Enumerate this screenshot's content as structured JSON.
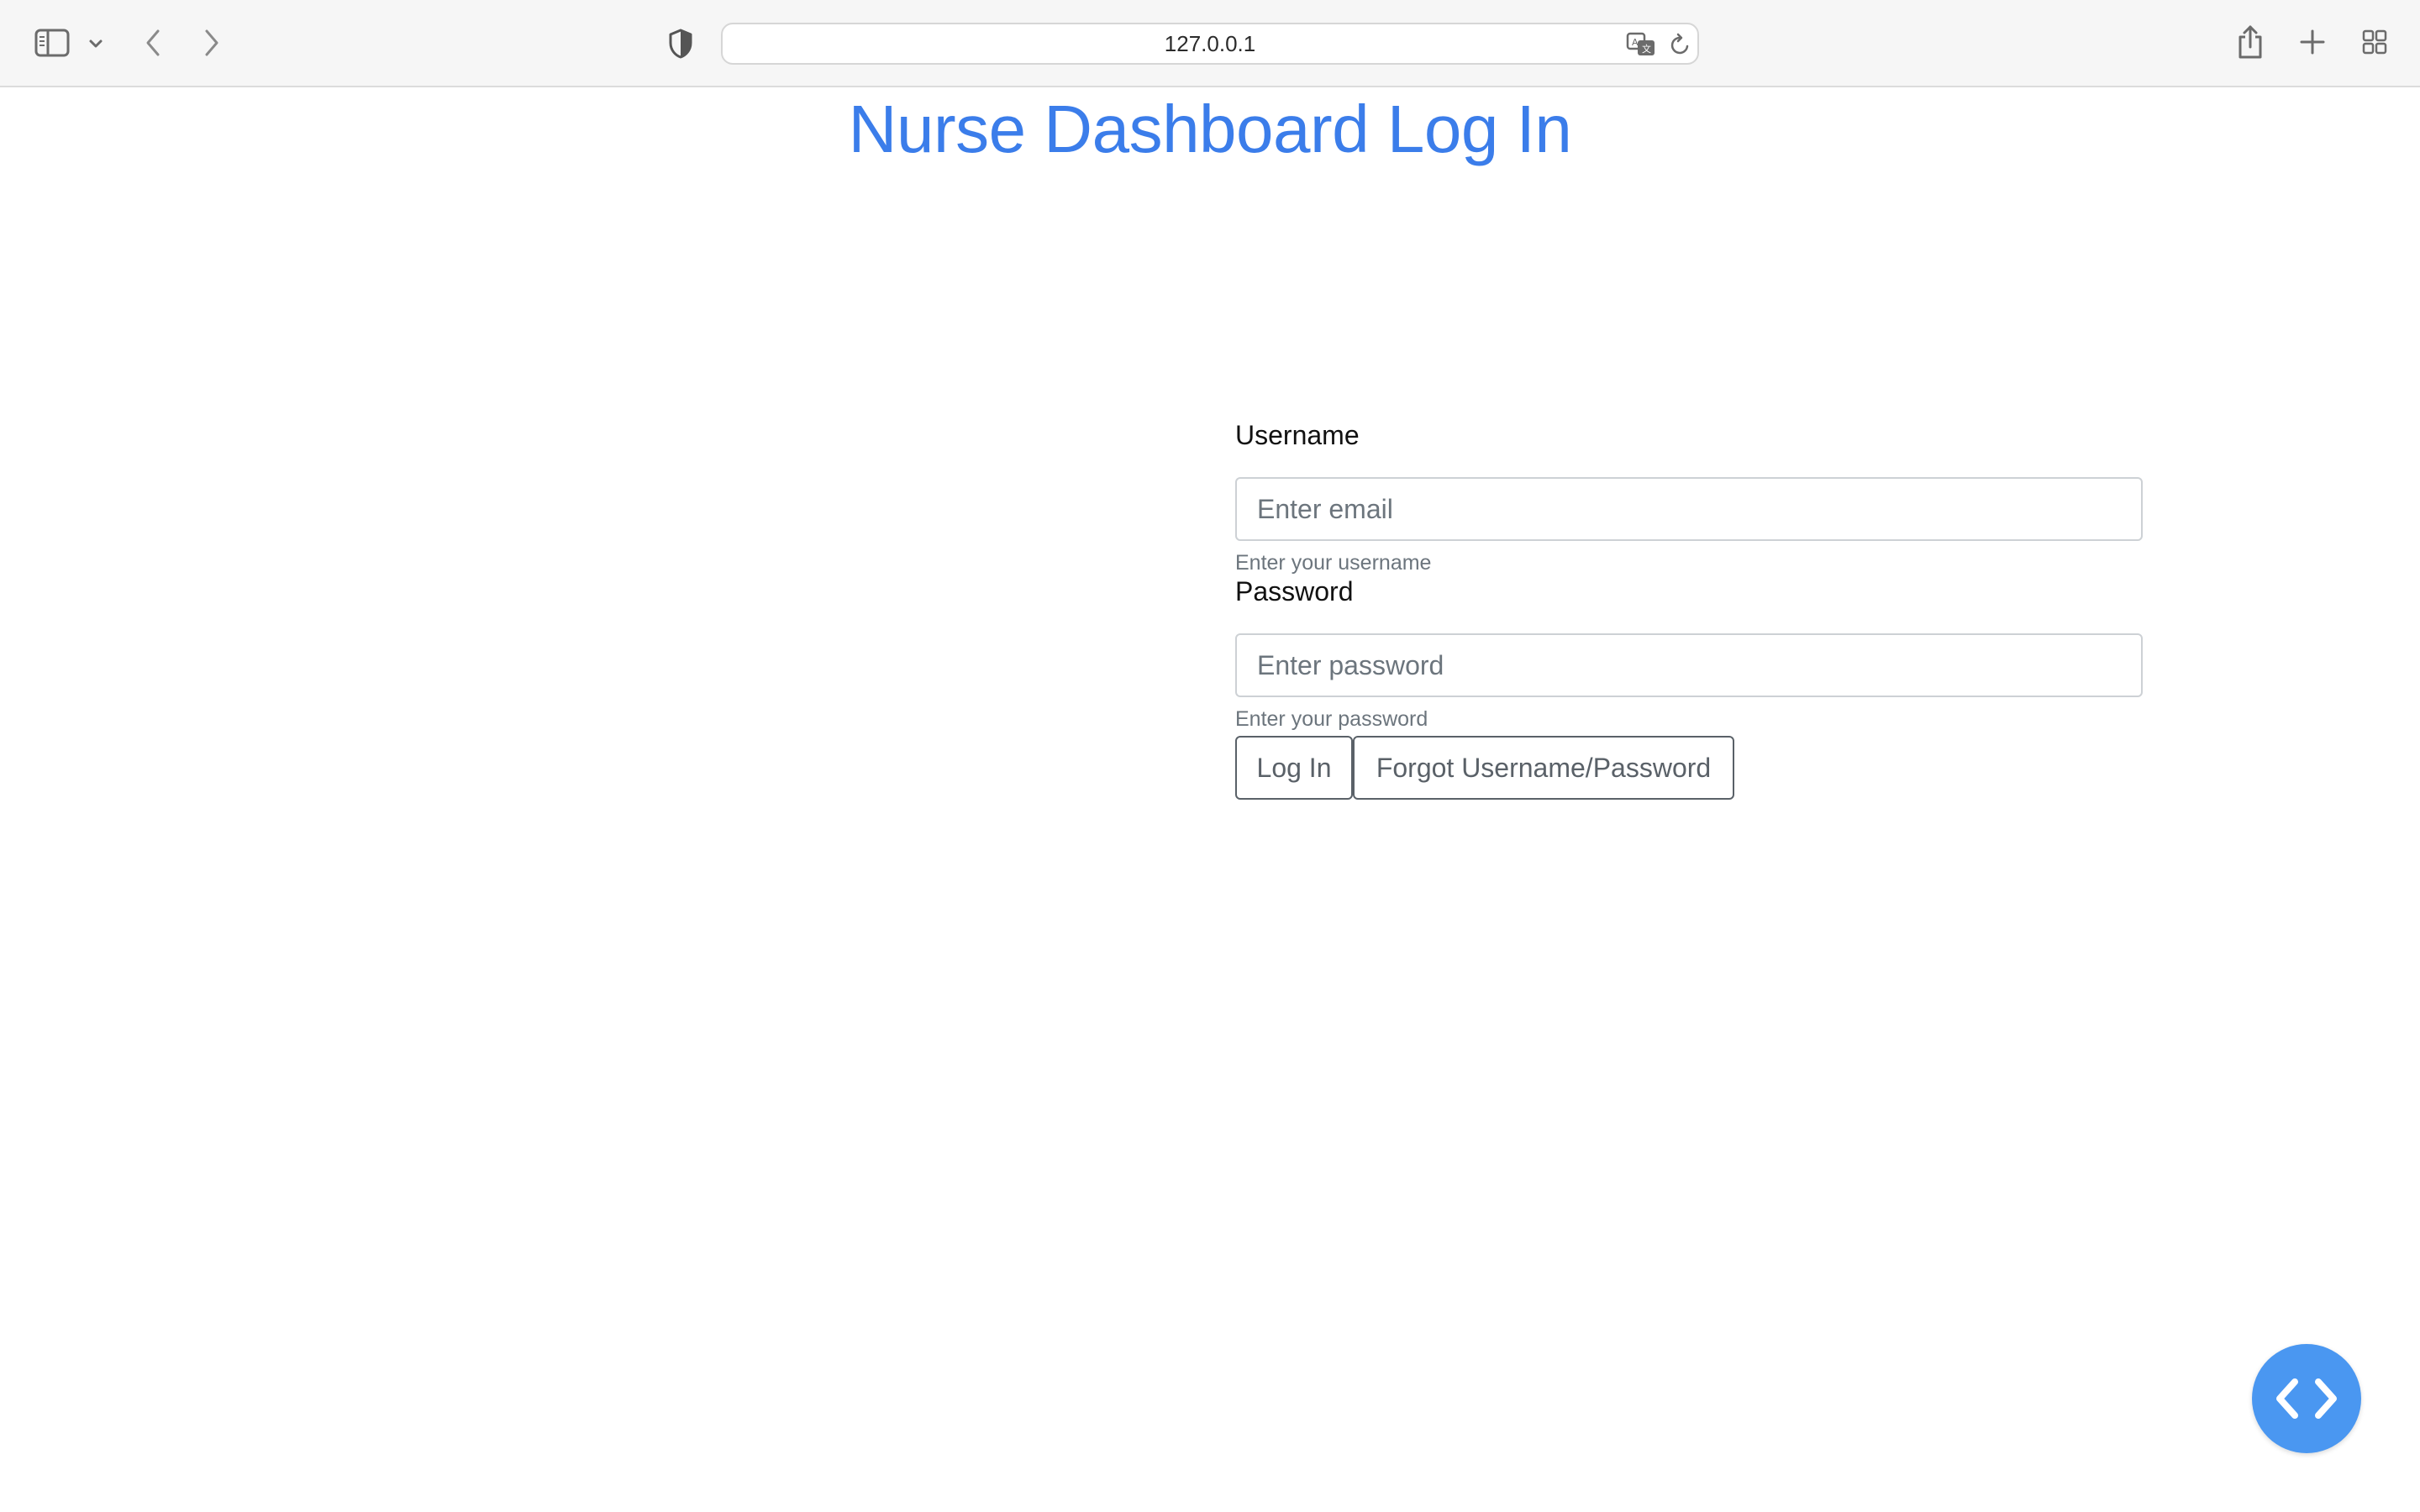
{
  "browser": {
    "url": "127.0.0.1",
    "icons": {
      "sidebar": "sidebar-icon",
      "sidebar_menu": "chevron-down-icon",
      "back": "back-icon",
      "forward": "forward-icon",
      "privacy": "shield-icon",
      "translate": "translate-icon",
      "reload": "reload-icon",
      "share": "share-icon",
      "new_tab": "plus-icon",
      "tab_overview": "grid-icon"
    }
  },
  "page": {
    "title": "Nurse Dashboard Log In",
    "title_color": "#3b7dea"
  },
  "form": {
    "username": {
      "label": "Username",
      "placeholder": "Enter email",
      "value": "",
      "help": "Enter your username"
    },
    "password": {
      "label": "Password",
      "placeholder": "Enter password",
      "value": "",
      "help": "Enter your password"
    },
    "buttons": {
      "login": "Log In",
      "forgot": "Forgot Username/Password"
    }
  },
  "fab": {
    "icon": "code-icon",
    "color": "#4a97f1"
  }
}
